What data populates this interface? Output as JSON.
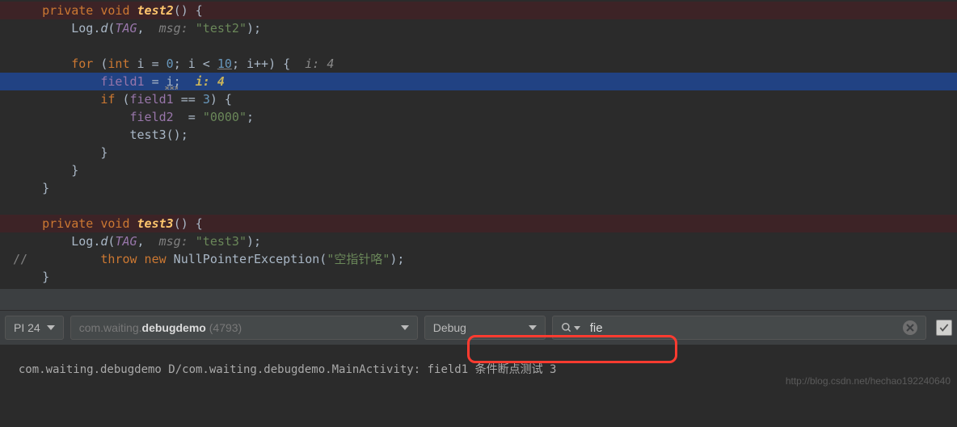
{
  "code": {
    "test2_sig_private": "private",
    "test2_sig_void": " void",
    "test2_sig_name": " test2",
    "test2_sig_paren": "() {",
    "log_d_class": "Log",
    "log_d_dot": ".",
    "log_d_fn": "d",
    "log_d_open": "(",
    "log_d_tag": "TAG",
    "log_d_comma": ", ",
    "log_d_hint1": " msg: ",
    "log_d_val1": "\"test2\"",
    "log_d_close": ");",
    "for_kw": "for",
    "for_open": " (",
    "for_type": "int",
    "for_decl": " i = ",
    "for_zero": "0",
    "for_semi1": "; i < ",
    "for_ten": "10",
    "for_semi2": "; i++) {  ",
    "for_inline": "i: 4",
    "assign_field": "field1",
    "assign_eq": " = i;  ",
    "assign_inline": "i: 4",
    "if_kw": "if",
    "if_open": " (",
    "if_field": "field1",
    "if_cond": " == ",
    "if_three": "3",
    "if_close": ") {",
    "field2": "field2",
    "field2_eq": "  = ",
    "field2_val": "\"0000\"",
    "field2_semi": ";",
    "test3_call": "test3();",
    "close1": "}",
    "close2": "}",
    "close3": "}",
    "test3_sig_private": "private",
    "test3_sig_void": " void",
    "test3_sig_name": " test3",
    "test3_sig_paren": "() {",
    "log_d_hint2": " msg: ",
    "log_d_val2": "\"test3\"",
    "comment_mark": "//",
    "throw_kw": "throw new",
    "throw_cls": " NullPointerException(",
    "throw_str": "\"空指针咯\"",
    "throw_close": ");",
    "close4": "}"
  },
  "toolbar": {
    "api": "PI 24",
    "process_pkg": "com.waiting.",
    "process_name": "debugdemo",
    "process_pid": " (4793)",
    "filter": "Debug",
    "search_value": "fie",
    "search_placeholder": ""
  },
  "log": {
    "line": "com.waiting.debugdemo D/com.waiting.debugdemo.MainActivity: field1 条件断点测试 3"
  },
  "watermark": "http://blog.csdn.net/hechao192240640"
}
